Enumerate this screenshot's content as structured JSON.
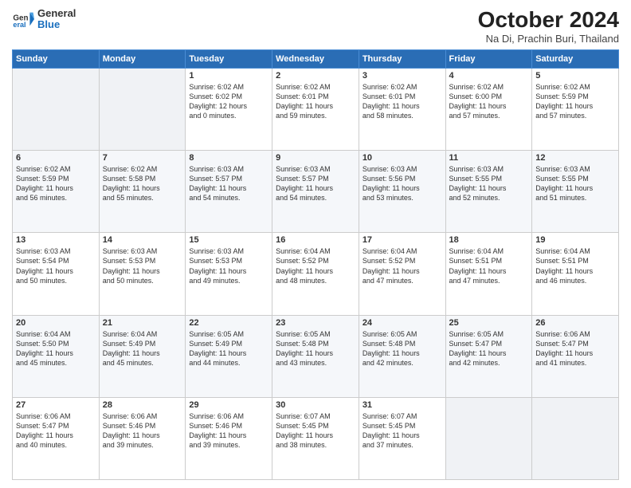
{
  "header": {
    "logo_general": "General",
    "logo_blue": "Blue",
    "month_title": "October 2024",
    "location": "Na Di, Prachin Buri, Thailand"
  },
  "days_of_week": [
    "Sunday",
    "Monday",
    "Tuesday",
    "Wednesday",
    "Thursday",
    "Friday",
    "Saturday"
  ],
  "weeks": [
    [
      {
        "day": "",
        "info": ""
      },
      {
        "day": "",
        "info": ""
      },
      {
        "day": "1",
        "info": "Sunrise: 6:02 AM\nSunset: 6:02 PM\nDaylight: 12 hours\nand 0 minutes."
      },
      {
        "day": "2",
        "info": "Sunrise: 6:02 AM\nSunset: 6:01 PM\nDaylight: 11 hours\nand 59 minutes."
      },
      {
        "day": "3",
        "info": "Sunrise: 6:02 AM\nSunset: 6:01 PM\nDaylight: 11 hours\nand 58 minutes."
      },
      {
        "day": "4",
        "info": "Sunrise: 6:02 AM\nSunset: 6:00 PM\nDaylight: 11 hours\nand 57 minutes."
      },
      {
        "day": "5",
        "info": "Sunrise: 6:02 AM\nSunset: 5:59 PM\nDaylight: 11 hours\nand 57 minutes."
      }
    ],
    [
      {
        "day": "6",
        "info": "Sunrise: 6:02 AM\nSunset: 5:59 PM\nDaylight: 11 hours\nand 56 minutes."
      },
      {
        "day": "7",
        "info": "Sunrise: 6:02 AM\nSunset: 5:58 PM\nDaylight: 11 hours\nand 55 minutes."
      },
      {
        "day": "8",
        "info": "Sunrise: 6:03 AM\nSunset: 5:57 PM\nDaylight: 11 hours\nand 54 minutes."
      },
      {
        "day": "9",
        "info": "Sunrise: 6:03 AM\nSunset: 5:57 PM\nDaylight: 11 hours\nand 54 minutes."
      },
      {
        "day": "10",
        "info": "Sunrise: 6:03 AM\nSunset: 5:56 PM\nDaylight: 11 hours\nand 53 minutes."
      },
      {
        "day": "11",
        "info": "Sunrise: 6:03 AM\nSunset: 5:55 PM\nDaylight: 11 hours\nand 52 minutes."
      },
      {
        "day": "12",
        "info": "Sunrise: 6:03 AM\nSunset: 5:55 PM\nDaylight: 11 hours\nand 51 minutes."
      }
    ],
    [
      {
        "day": "13",
        "info": "Sunrise: 6:03 AM\nSunset: 5:54 PM\nDaylight: 11 hours\nand 50 minutes."
      },
      {
        "day": "14",
        "info": "Sunrise: 6:03 AM\nSunset: 5:53 PM\nDaylight: 11 hours\nand 50 minutes."
      },
      {
        "day": "15",
        "info": "Sunrise: 6:03 AM\nSunset: 5:53 PM\nDaylight: 11 hours\nand 49 minutes."
      },
      {
        "day": "16",
        "info": "Sunrise: 6:04 AM\nSunset: 5:52 PM\nDaylight: 11 hours\nand 48 minutes."
      },
      {
        "day": "17",
        "info": "Sunrise: 6:04 AM\nSunset: 5:52 PM\nDaylight: 11 hours\nand 47 minutes."
      },
      {
        "day": "18",
        "info": "Sunrise: 6:04 AM\nSunset: 5:51 PM\nDaylight: 11 hours\nand 47 minutes."
      },
      {
        "day": "19",
        "info": "Sunrise: 6:04 AM\nSunset: 5:51 PM\nDaylight: 11 hours\nand 46 minutes."
      }
    ],
    [
      {
        "day": "20",
        "info": "Sunrise: 6:04 AM\nSunset: 5:50 PM\nDaylight: 11 hours\nand 45 minutes."
      },
      {
        "day": "21",
        "info": "Sunrise: 6:04 AM\nSunset: 5:49 PM\nDaylight: 11 hours\nand 45 minutes."
      },
      {
        "day": "22",
        "info": "Sunrise: 6:05 AM\nSunset: 5:49 PM\nDaylight: 11 hours\nand 44 minutes."
      },
      {
        "day": "23",
        "info": "Sunrise: 6:05 AM\nSunset: 5:48 PM\nDaylight: 11 hours\nand 43 minutes."
      },
      {
        "day": "24",
        "info": "Sunrise: 6:05 AM\nSunset: 5:48 PM\nDaylight: 11 hours\nand 42 minutes."
      },
      {
        "day": "25",
        "info": "Sunrise: 6:05 AM\nSunset: 5:47 PM\nDaylight: 11 hours\nand 42 minutes."
      },
      {
        "day": "26",
        "info": "Sunrise: 6:06 AM\nSunset: 5:47 PM\nDaylight: 11 hours\nand 41 minutes."
      }
    ],
    [
      {
        "day": "27",
        "info": "Sunrise: 6:06 AM\nSunset: 5:47 PM\nDaylight: 11 hours\nand 40 minutes."
      },
      {
        "day": "28",
        "info": "Sunrise: 6:06 AM\nSunset: 5:46 PM\nDaylight: 11 hours\nand 39 minutes."
      },
      {
        "day": "29",
        "info": "Sunrise: 6:06 AM\nSunset: 5:46 PM\nDaylight: 11 hours\nand 39 minutes."
      },
      {
        "day": "30",
        "info": "Sunrise: 6:07 AM\nSunset: 5:45 PM\nDaylight: 11 hours\nand 38 minutes."
      },
      {
        "day": "31",
        "info": "Sunrise: 6:07 AM\nSunset: 5:45 PM\nDaylight: 11 hours\nand 37 minutes."
      },
      {
        "day": "",
        "info": ""
      },
      {
        "day": "",
        "info": ""
      }
    ]
  ]
}
